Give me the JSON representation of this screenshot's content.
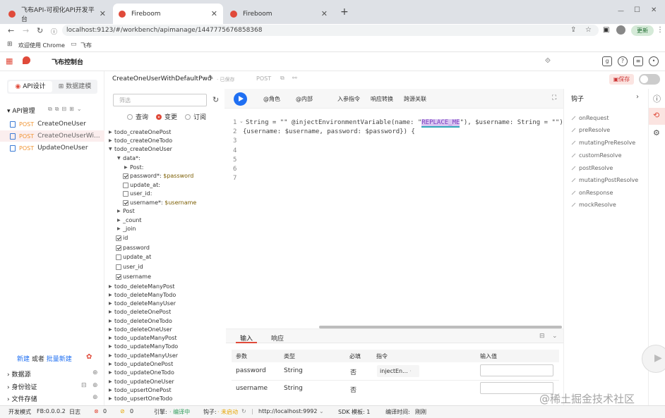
{
  "browser": {
    "tabs": [
      {
        "title": "飞布API-可视化API开发平台"
      },
      {
        "title": "Fireboom"
      },
      {
        "title": "Fireboom"
      }
    ],
    "new_tab_label": "+",
    "url": "localhost:9123/#/workbench/apimanage/1447775676858368",
    "bookmarks": [
      {
        "label": "欢迎使用 Chrome"
      },
      {
        "label": "飞布"
      }
    ],
    "update_label": "更新"
  },
  "app": {
    "title": "飞布控制台",
    "save_label": "保存"
  },
  "left_panel": {
    "tabs": [
      "API设计",
      "数据建模"
    ],
    "section_title": "API管理",
    "apis": [
      {
        "method": "POST",
        "name": "CreateOneUser"
      },
      {
        "method": "POST",
        "name": "CreateOneUserWi..."
      },
      {
        "method": "POST",
        "name": "UpdateOneUser"
      }
    ],
    "new_link": "新建",
    "or_text": "或者",
    "batch_link": "批量新建",
    "sections": [
      "数据源",
      "身份验证",
      "文件存储"
    ]
  },
  "api_header": {
    "name": "CreateOneUserWithDefaultPwd",
    "saved": "已保存",
    "method": "POST"
  },
  "query_panel": {
    "filter_placeholder": "筛选",
    "radios": [
      "查询",
      "变更",
      "订阅"
    ],
    "tree": [
      {
        "label": "todo_createOnePost"
      },
      {
        "label": "todo_createOneTodo"
      },
      {
        "label": "todo_createOneUser"
      },
      {
        "label": "data*:"
      },
      {
        "label": "Post:"
      },
      {
        "label": "password*:",
        "value": "$password"
      },
      {
        "label": "update_at:"
      },
      {
        "label": "user_id:"
      },
      {
        "label": "username*:",
        "value": "$username"
      },
      {
        "label": "Post"
      },
      {
        "label": "_count"
      },
      {
        "label": "_join"
      },
      {
        "label": "id"
      },
      {
        "label": "password"
      },
      {
        "label": "update_at"
      },
      {
        "label": "user_id"
      },
      {
        "label": "username"
      },
      {
        "label": "todo_deleteManyPost"
      },
      {
        "label": "todo_deleteManyTodo"
      },
      {
        "label": "todo_deleteManyUser"
      },
      {
        "label": "todo_deleteOnePost"
      },
      {
        "label": "todo_deleteOneTodo"
      },
      {
        "label": "todo_deleteOneUser"
      },
      {
        "label": "todo_updateManyPost"
      },
      {
        "label": "todo_updateManyTodo"
      },
      {
        "label": "todo_updateManyUser"
      },
      {
        "label": "todo_updateOnePost"
      },
      {
        "label": "todo_updateOneTodo"
      },
      {
        "label": "todo_updateOneUser"
      },
      {
        "label": "todo_upsertOnePost"
      },
      {
        "label": "todo_upsertOneTodo"
      }
    ]
  },
  "toolbar": {
    "buttons": [
      "@角色",
      "@内部",
      "入参指令",
      "响应转换",
      "跨源关联"
    ]
  },
  "editor": {
    "line_numbers": [
      "1",
      "2",
      "3",
      "4",
      "5",
      "6",
      "7"
    ],
    "line1_a": "String = \"\" @injectEnvironmentVariable(name: \"",
    "line1_highlight": "REPLACE_ME",
    "line1_b": "\"), $username: String = \"\") {",
    "line2": "{username: $username, password: $password}) {"
  },
  "hooks": {
    "title": "钩子",
    "items": [
      "onRequest",
      "preResolve",
      "mutatingPreResolve",
      "customResolve",
      "postResolve",
      "mutatingPostResolve",
      "onResponse",
      "mockResolve"
    ]
  },
  "bottom_panel": {
    "tabs": [
      "输入",
      "响应"
    ],
    "columns": [
      "参数",
      "类型",
      "必填",
      "指令",
      "输入值"
    ],
    "rows": [
      {
        "param": "password",
        "type": "String",
        "required": "否",
        "directive": "injectEn..."
      },
      {
        "param": "username",
        "type": "String",
        "required": "否",
        "directive": ""
      }
    ]
  },
  "statusbar": {
    "mode": "开发模式",
    "version": "FB:0.0.0.2",
    "log": "日志",
    "errors": "0",
    "warnings": "0",
    "engine_label": "引擎:",
    "engine_status": "编译中",
    "hooks_label": "钩子:",
    "hooks_status": "未启动",
    "host": "http://localhost:9992",
    "sdk": "SDK 模板: 1",
    "compile_label": "编译时间:",
    "compile_value": "刚刚"
  },
  "watermark": "@稀土掘金技术社区",
  "colors": {
    "accent_red": "#e04a3a",
    "primary_blue": "#1f6ff2",
    "post_orange": "#f09433",
    "update_green": "#2e9c5a"
  }
}
